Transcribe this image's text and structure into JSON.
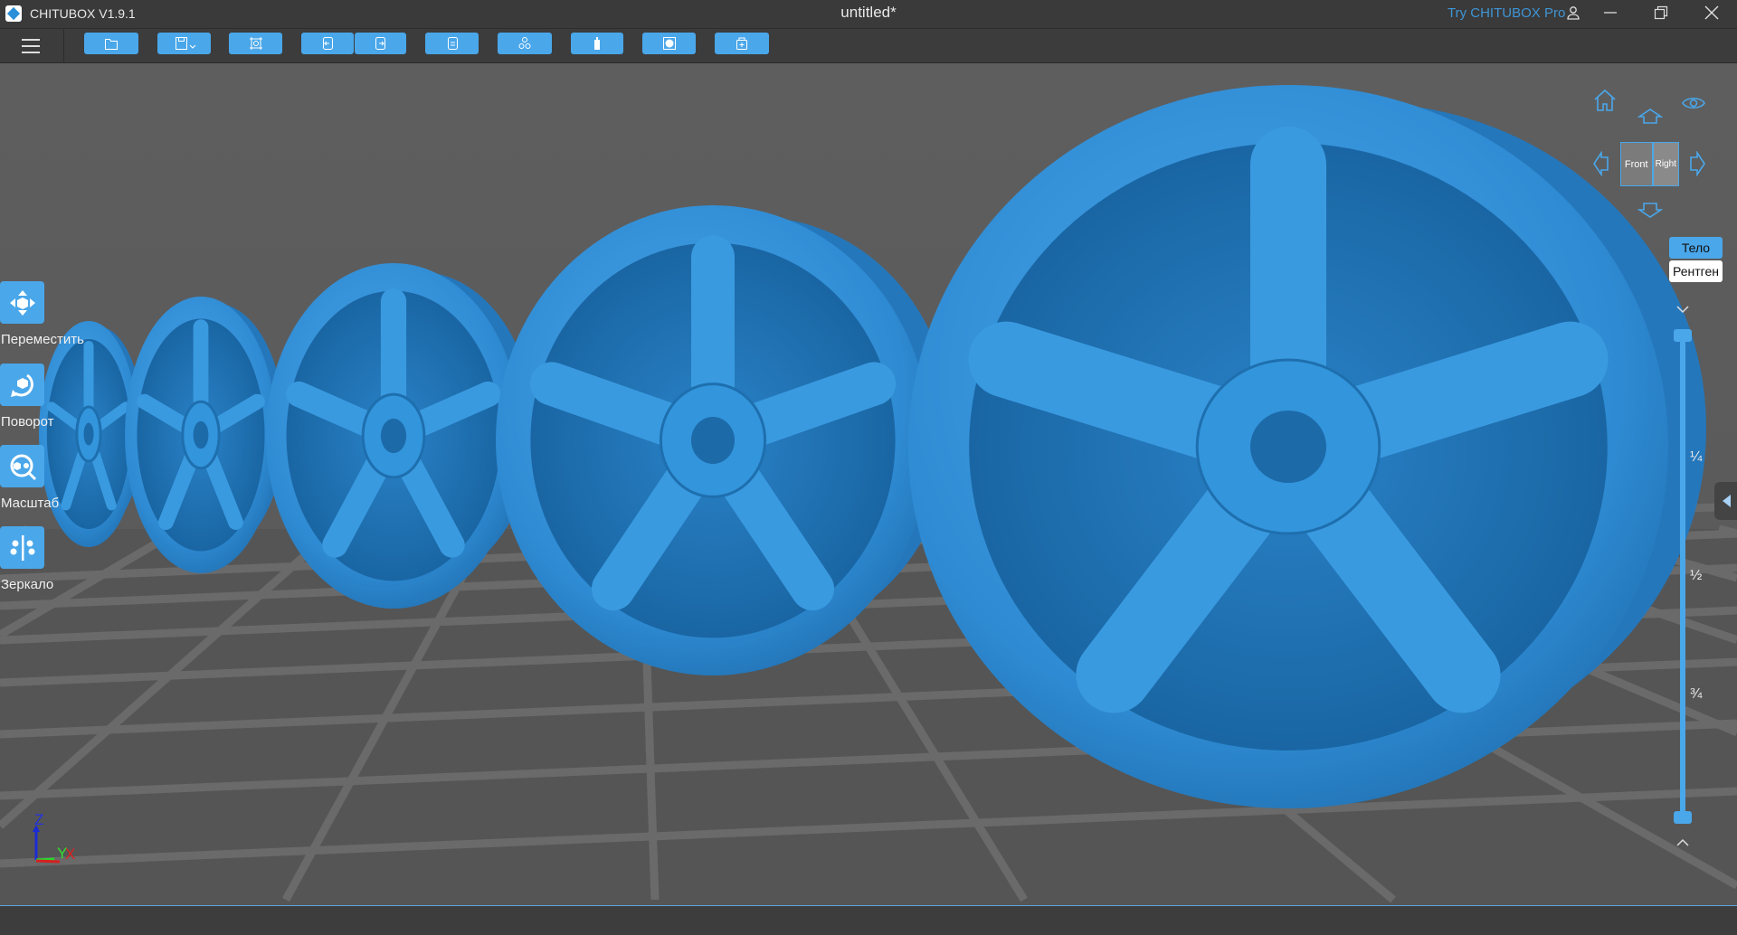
{
  "titlebar": {
    "app_name": "CHITUBOX V1.9.1",
    "document_title": "untitled*",
    "try_pro": "Try CHITUBOX Pro"
  },
  "toolbar": {
    "buttons": [
      "open-file",
      "save",
      "auto-layout",
      "undo",
      "redo",
      "slice-settings",
      "group",
      "supports",
      "hollow",
      "add-drain-hole"
    ]
  },
  "tools": [
    {
      "label": "Переместить",
      "icon": "move-icon"
    },
    {
      "label": "Поворот",
      "icon": "rotate-icon"
    },
    {
      "label": "Масштаб",
      "icon": "scale-icon"
    },
    {
      "label": "Зеркало",
      "icon": "mirror-icon"
    }
  ],
  "view_cube": {
    "front": "Front",
    "right": "Right"
  },
  "render_mode": {
    "solid": "Тело",
    "xray": "Рентген",
    "active": "Тело"
  },
  "layer_slider": {
    "marks": [
      "¼",
      "½",
      "¾"
    ],
    "top_value": 1.0,
    "bottom_value": 0.0
  },
  "axes": {
    "z": "Z",
    "y": "Y",
    "x": "X"
  },
  "colors": {
    "accent": "#4aa7ea",
    "model": "#2f8fd6",
    "link": "#3e95d6"
  }
}
